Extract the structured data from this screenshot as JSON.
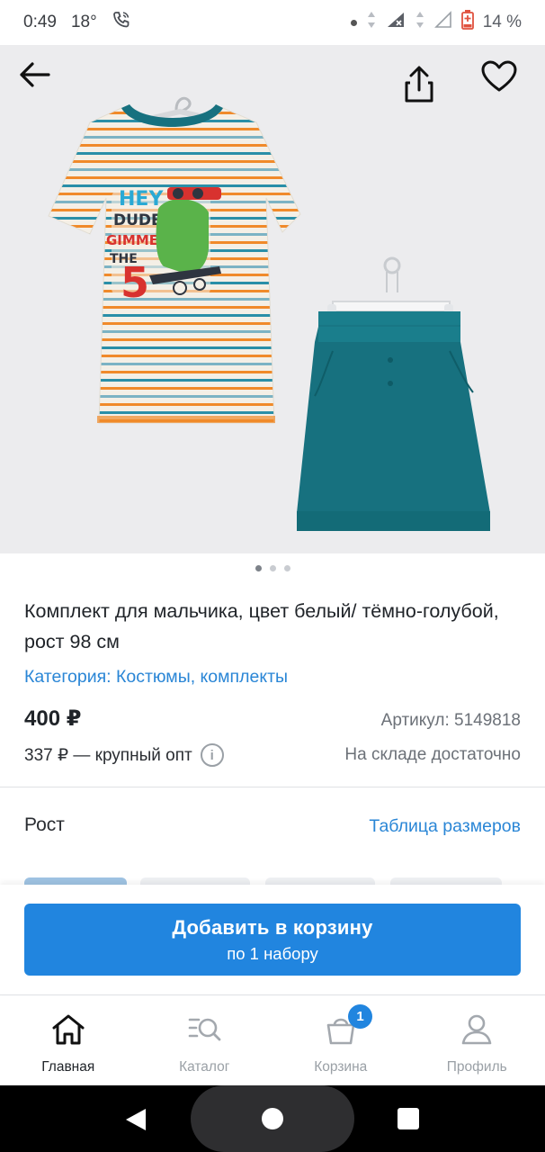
{
  "status_bar": {
    "time": "0:49",
    "temperature": "18°",
    "battery": "14 %"
  },
  "product": {
    "title": "Комплект для мальчика, цвет белый/ тёмно-голубой, рост 98 см",
    "category": "Категория: Костюмы, комплекты",
    "price": "400 ₽",
    "sku": "Артикул: 5149818",
    "wholesale": "337 ₽ — крупный опт",
    "stock": "На складе достаточно"
  },
  "gallery": {
    "image_count": 3,
    "active_index": 0
  },
  "size": {
    "label": "Рост",
    "table_link": "Таблица размеров"
  },
  "cart": {
    "button_title": "Добавить в корзину",
    "button_subtitle": "по 1 набору"
  },
  "tabs": [
    {
      "label": "Главная",
      "icon": "home-icon",
      "active": true
    },
    {
      "label": "Каталог",
      "icon": "catalog-search-icon",
      "active": false
    },
    {
      "label": "Корзина",
      "icon": "basket-icon",
      "active": false,
      "badge": "1"
    },
    {
      "label": "Профиль",
      "icon": "profile-icon",
      "active": false
    }
  ],
  "colors": {
    "accent": "#2185df",
    "link": "#2a86d6",
    "shirt_teal": "#17717f",
    "stripe_orange": "#f08a2a"
  }
}
